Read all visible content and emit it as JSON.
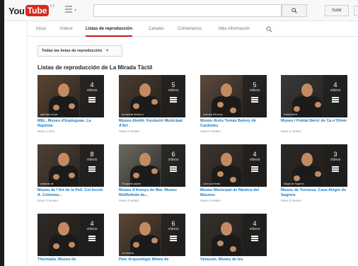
{
  "header": {
    "logo_you": "You",
    "logo_tube": "Tube",
    "logo_sup": "ES",
    "upload_label": "Subir"
  },
  "tabs": [
    {
      "label": "Inicio"
    },
    {
      "label": "Vídeos"
    },
    {
      "label": "Listas de reproducción",
      "active": true
    },
    {
      "label": "Canales"
    },
    {
      "label": "Comentarios"
    },
    {
      "label": "Más información"
    }
  ],
  "filter": {
    "label": "Todas las listas de reproducción"
  },
  "section_title": "Listas de reproducción de La Mirada Tàctil",
  "count_word": "vídeos",
  "playlists": [
    {
      "title": "MEL. Museu d'Espluguas. La Rajoleta",
      "meta": "Hace 1 mes",
      "count": "4",
      "caption": "quel dos mil per",
      "bg": "#5a4534"
    },
    {
      "title": "Museu Abelló. Fundació Municipal d'Art",
      "meta": "Hace 2 meses",
      "count": "5",
      "caption": "la moneda deixeu a",
      "bg": "#4a3b30"
    },
    {
      "title": "Museu Arxiu Tomàs Balvey de Cardedeu",
      "meta": "Hace 2 meses",
      "count": "5",
      "caption": "com ara 200 anys",
      "bg": "#5b4a3d"
    },
    {
      "title": "Museu I Poblat Ibèric de Ca n'Oliver",
      "meta": "Hace 2 meses",
      "count": "4",
      "caption": "Poblat ibèric",
      "bg": "#3a3a3a"
    },
    {
      "title": "Museu de l'Art de la Pell. Col·lecció A. Colomas...",
      "meta": "Hace 2 meses",
      "count": "8",
      "caption": "adoberia de",
      "bg": "#4e4137"
    },
    {
      "title": "Museu d'Arenys de Mar. Museu Mollfulleda de...",
      "meta": "Hace 3 meses",
      "count": "6",
      "caption": "Té aquest capítol",
      "bg": "#6d6a63"
    },
    {
      "title": "Museu Municipal de Nàutica del Masnou",
      "meta": "Hace 3 meses",
      "count": "4",
      "caption": "com a col·lectiu",
      "bg": "#3d3430"
    },
    {
      "title": "Museu de Terrassa. Casa Alegre de Sagrera",
      "meta": "Hace 3 meses",
      "count": "3",
      "caption": "Alegre de Sagrera",
      "bg": "#2b2826"
    },
    {
      "title": "Thermalia. Museu de",
      "meta": "",
      "count": "4",
      "caption": "",
      "bg": "#2d2a28"
    },
    {
      "title": "Parc Arqueològic Mines de",
      "meta": "",
      "count": "6",
      "caption": "i el mineria",
      "bg": "#5a4636"
    },
    {
      "title": "Vinseum. Museu de les",
      "meta": "",
      "count": "4",
      "caption": "",
      "bg": "#34302c"
    }
  ],
  "colors": {
    "accent": "#cc181e",
    "link": "#167ac6",
    "logo_red": "#d52b1e"
  }
}
